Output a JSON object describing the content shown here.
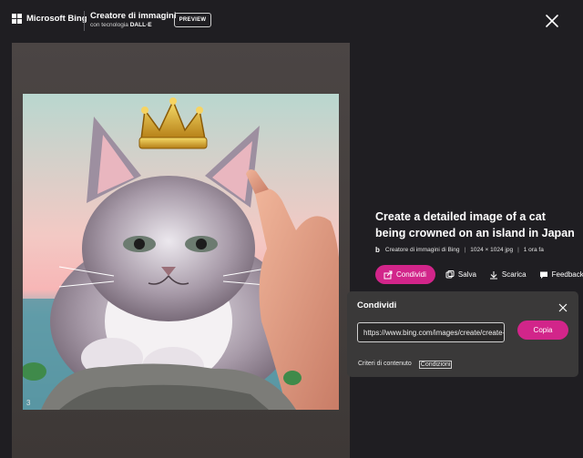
{
  "header": {
    "brand": "Microsoft Bing",
    "app_title": "Creatore di immagini",
    "subtitle_prefix": "con tecnologia",
    "subtitle_model": "DALL·E",
    "badge": "PREVIEW"
  },
  "image": {
    "counter": "3"
  },
  "details": {
    "prompt": "Create a detailed image of a cat being crowned on an island in Japan",
    "meta_icon": "b",
    "source": "Creatore di immagini di Bing",
    "size": "1024 × 1024 jpg",
    "age": "1 ora fa"
  },
  "actions": {
    "share": "Condividi",
    "save": "Salva",
    "download": "Scarica",
    "feedback": "Feedback"
  },
  "share_popup": {
    "title": "Condividi",
    "url": "https://www.bing.com/images/create/create-a-detailed-image",
    "copy": "Copia",
    "link_content": "Criteri di contenuto",
    "link_terms": "Condizioni"
  },
  "colors": {
    "accent": "#d2258a",
    "background": "#1f1e22",
    "panel": "#3a3939"
  }
}
